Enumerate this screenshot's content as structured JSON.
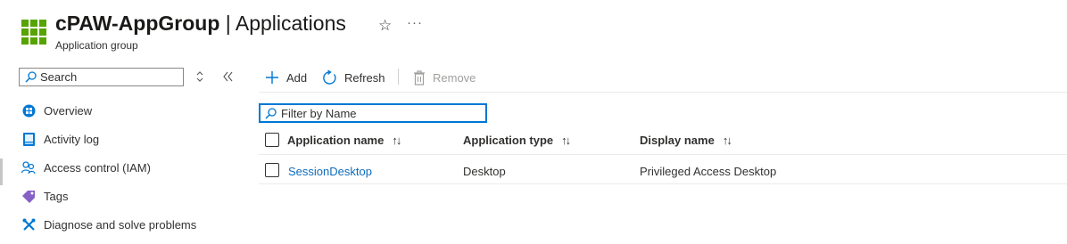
{
  "header": {
    "title_main": "cPAW-AppGroup",
    "title_rest": " | Applications",
    "subtitle": "Application group",
    "icon": "app-grid-icon",
    "brand_color": "#57a300"
  },
  "nav": {
    "search_placeholder": "Search",
    "items": [
      {
        "label": "Overview",
        "icon": "overview-icon"
      },
      {
        "label": "Activity log",
        "icon": "activity-log-icon"
      },
      {
        "label": "Access control (IAM)",
        "icon": "people-icon"
      },
      {
        "label": "Tags",
        "icon": "tag-icon"
      },
      {
        "label": "Diagnose and solve problems",
        "icon": "wrench-icon"
      }
    ]
  },
  "toolbar": {
    "add_label": "Add",
    "refresh_label": "Refresh",
    "remove_label": "Remove"
  },
  "filter": {
    "placeholder": "Filter by Name"
  },
  "table": {
    "columns": [
      "Application name",
      "Application type",
      "Display name"
    ],
    "sort_glyph": "↑↓",
    "rows": [
      {
        "name": "SessionDesktop",
        "type": "Desktop",
        "display": "Privileged Access Desktop"
      }
    ]
  },
  "colors": {
    "accent": "#0078d4",
    "link": "#0f6cbd",
    "disabled": "#a19f9d"
  }
}
